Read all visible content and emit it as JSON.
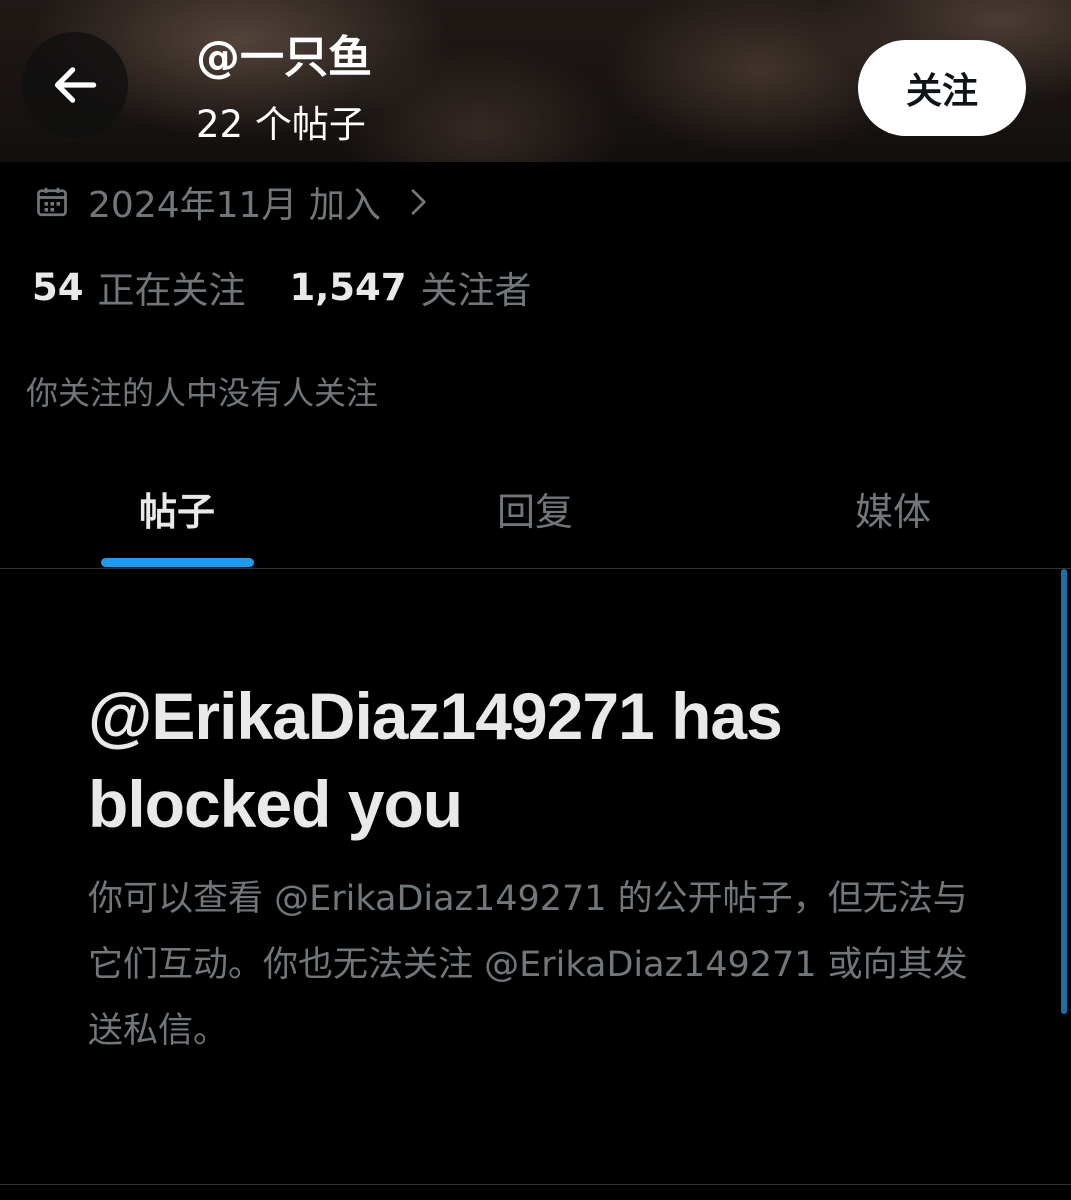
{
  "header": {
    "profile_name": "@一只鱼",
    "post_count": "22 个帖子",
    "back_icon": "arrow-left-icon",
    "follow_label": "关注"
  },
  "profile": {
    "join_date": "2024年11月 加入",
    "calendar_icon": "calendar-icon",
    "chevron_icon": "chevron-right-icon",
    "following_count": "54",
    "following_label": "正在关注",
    "followers_count": "1,547",
    "followers_label": "关注者",
    "followers_you_know": "你关注的人中没有人关注"
  },
  "tabs": [
    {
      "label": "帖子",
      "active": true
    },
    {
      "label": "回复",
      "active": false
    },
    {
      "label": "媒体",
      "active": false
    }
  ],
  "blocked": {
    "title": "@ErikaDiaz149271 has blocked you",
    "description": "你可以查看 @ErikaDiaz149271 的公开帖子，但无法与它们互动。你也无法关注 @ErikaDiaz149271 或向其发送私信。"
  },
  "colors": {
    "background": "#000000",
    "primary_text": "#e7e9ea",
    "secondary_text": "#71767b",
    "accent": "#1d9bf0",
    "follow_button_bg": "#ffffff"
  }
}
